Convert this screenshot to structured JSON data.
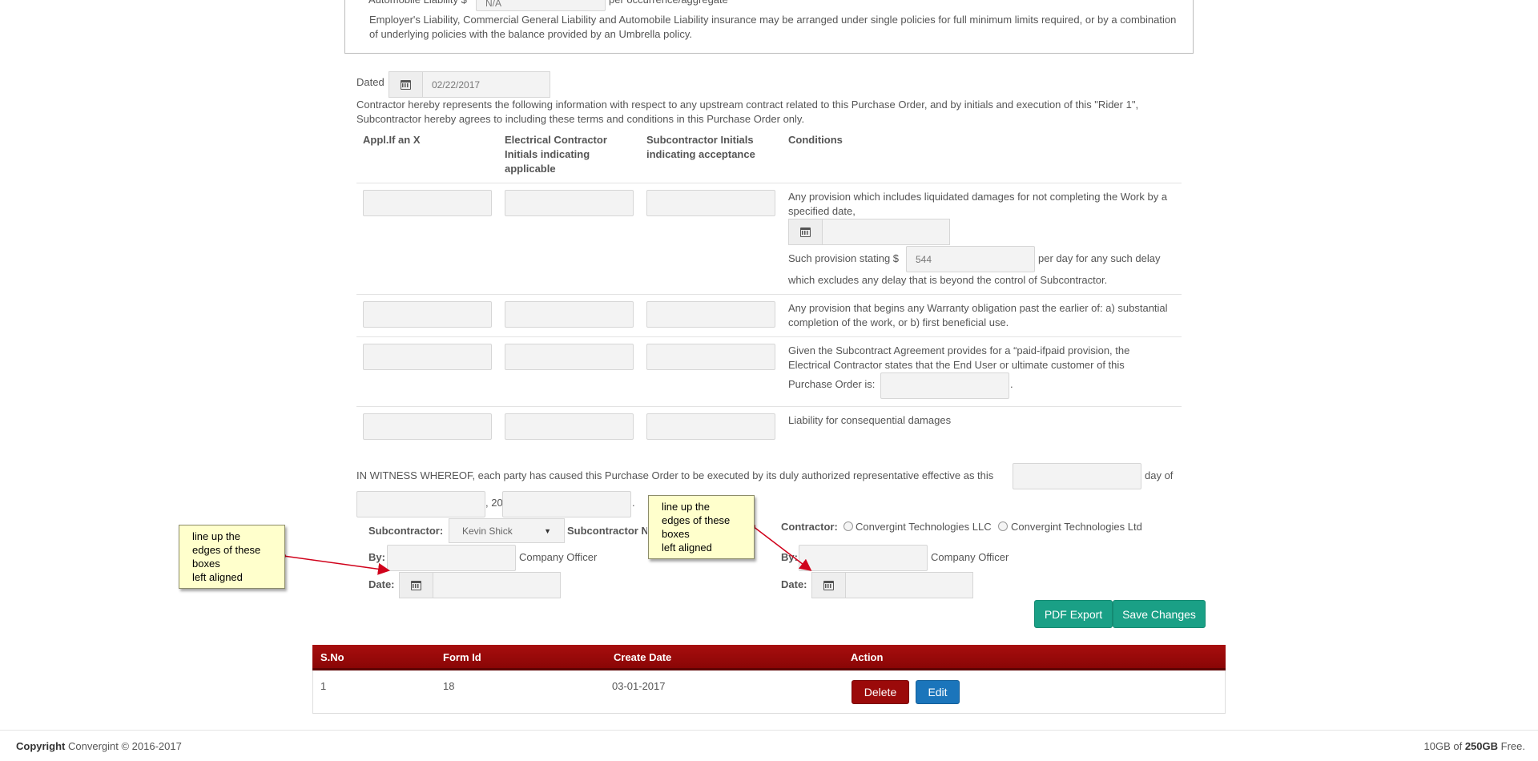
{
  "insurance": {
    "auto_liability_label": "Automobile Liability $",
    "auto_liability_value": "N/A",
    "auto_liability_suffix": "per occurrence/aggregate",
    "note": "Employer's Liability, Commercial General Liability and Automobile Liability insurance may be arranged under single policies for full minimum limits required, or by a combination of underlying policies with the balance provided by an Umbrella policy."
  },
  "dated": {
    "label": "Dated",
    "value": "02/22/2017"
  },
  "rider_intro": "Contractor hereby represents the following information with respect to any upstream contract related to this Purchase Order, and by initials and execution of this \"Rider 1\", Subcontractor hereby agrees to including these terms and conditions in this Purchase Order only.",
  "conditions_table": {
    "headers": [
      "Appl.If an X",
      "Electrical Contractor Initials indicating applicable",
      "Subcontractor Initials indicating acceptance",
      "Conditions"
    ],
    "row1": {
      "text": "Any provision which includes liquidated damages for not completing the Work by a specified date,",
      "provision_prefix": "Such provision stating $",
      "provision_value": "544",
      "provision_suffix": "per day for any such delay",
      "provision_tail": "which excludes any delay that is beyond the control of Subcontractor."
    },
    "row2": {
      "text": "Any provision that begins any Warranty obligation past the earlier of: a) substantial completion of the work, or b) first beneficial use."
    },
    "row3": {
      "text": "Given the Subcontract Agreement provides for a “paid-ifpaid provision, the Electrical Contractor states that the End User or ultimate customer of this",
      "tail": "Purchase Order is:",
      "end": "."
    },
    "row4": {
      "text": "Liability for consequential damages"
    }
  },
  "witness": {
    "text": "IN WITNESS WHEREOF, each party has caused this Purchase Order to be executed by its duly authorized representative effective as this",
    "day_of": "day of",
    "comma_20": ", 20",
    "period": "."
  },
  "subcontractor": {
    "label": "Subcontractor:",
    "selected": "Kevin Shick",
    "name_label": "Subcontractor N",
    "by_label": "By:",
    "officer": "Company Officer",
    "date_label": "Date:"
  },
  "contractor": {
    "label": "Contractor:",
    "options": [
      "Convergint Technologies LLC",
      "Convergint Technologies Ltd"
    ],
    "by_label": "By:",
    "officer": "Company Officer",
    "date_label": "Date:"
  },
  "notes": {
    "left": [
      "line up the",
      "edges of these",
      "boxes",
      "left aligned"
    ],
    "right": [
      "line up the",
      "edges of these",
      "boxes",
      "left aligned"
    ]
  },
  "buttons": {
    "pdf_export": "PDF Export",
    "save_changes": "Save Changes"
  },
  "records_table": {
    "headers": [
      "S.No",
      "Form Id",
      "Create Date",
      "Action"
    ],
    "rows": [
      {
        "sno": "1",
        "form_id": "18",
        "create_date": "03-01-2017",
        "delete": "Delete",
        "edit": "Edit"
      }
    ]
  },
  "footer": {
    "copyright_label": "Copyright",
    "copyright_text": "Convergint © 2016-2017",
    "storage_used": "10GB of",
    "storage_total": "250GB",
    "storage_suffix": "Free."
  },
  "colors": {
    "table_header": "#9b0a0a",
    "green_button": "#1aa086",
    "delete_button": "#9b0a0a",
    "edit_button": "#1b75bb",
    "note_bg": "#ffffcc"
  }
}
